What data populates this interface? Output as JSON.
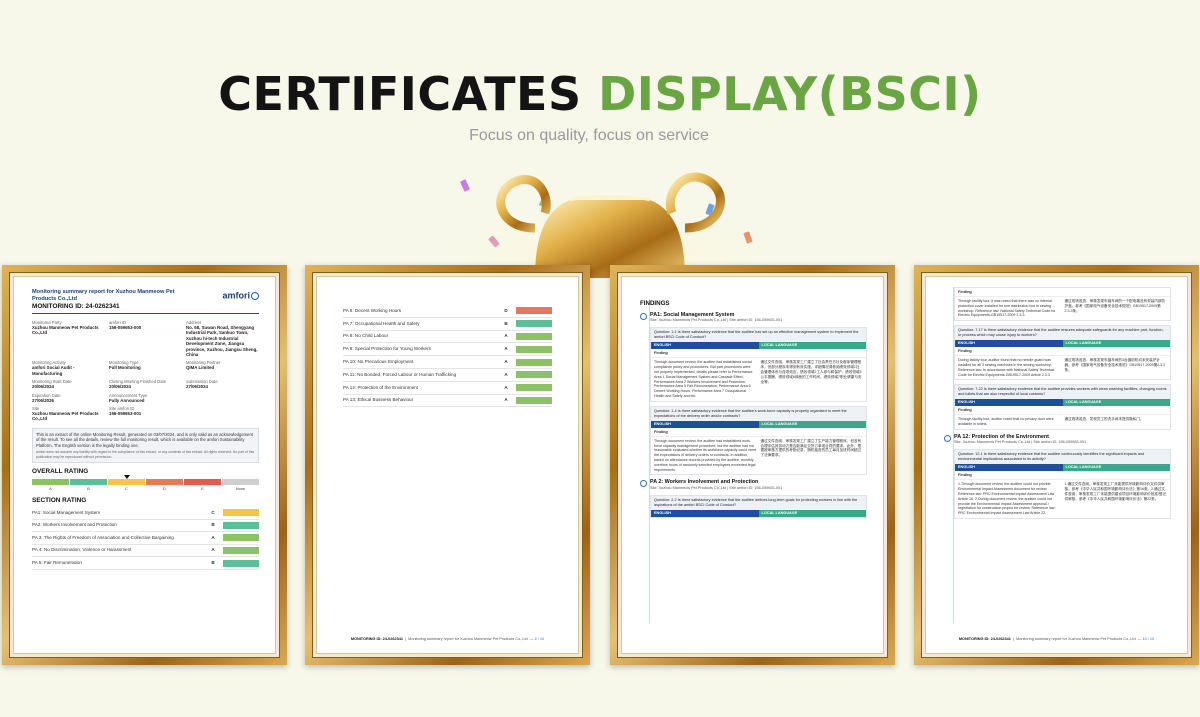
{
  "header": {
    "title_dark": "CERTIFICATES",
    "title_green": "DISPLAY(BSCI)",
    "subtitle": "Focus on quality, focus on service"
  },
  "colors": {
    "accent_green": "#6aa544",
    "grade_a": "#8cc265",
    "grade_b": "#5bbf9a",
    "grade_c": "#f4c54a",
    "grade_d": "#e8785c",
    "grade_e": "#e55a4a",
    "grade_none": "#cfcfcf"
  },
  "doc1": {
    "report_title": "Monitoring summary report for Xuzhou Manmeow Pet Products Co.,Ltd",
    "monitoring_id": "MONITORING ID: 24-0262341",
    "brand": "amfori",
    "fields": [
      {
        "label": "Monitored Party",
        "value": "Xuzhou Manmeow Pet Products Co.,Ltd"
      },
      {
        "label": "amfori ID",
        "value": "156-059653-000"
      },
      {
        "label": "Address",
        "value": "No. 68, Suwan Road, Shengyang Industrial Park, Sankuo Town, Xuzhou hi-tech Industrial Development Zone, Jiangsu province, Xuzhou, Jiangsu Sheng, China"
      },
      {
        "label": "Monitoring Activity",
        "value": "amfori Social Audit - Manufacturing"
      },
      {
        "label": "Monitoring Type",
        "value": "Full Monitoring"
      },
      {
        "label": "Monitoring Partner",
        "value": "QIMA Limited"
      },
      {
        "label": "Monitoring Start Date",
        "value": "20/06/2024"
      },
      {
        "label": "Closing Meeting Finished Date",
        "value": "20/06/2024"
      },
      {
        "label": "Submission Date",
        "value": "27/06/2024"
      },
      {
        "label": "Expiration Date",
        "value": "27/06/2026"
      },
      {
        "label": "Announcement Type",
        "value": "Fully Announced"
      },
      {
        "label": "",
        "value": ""
      },
      {
        "label": "Site",
        "value": "Xuzhou Manmeow Pet Products Co.,Ltd"
      },
      {
        "label": "Site amfori ID",
        "value": "156-059653-001"
      },
      {
        "label": "",
        "value": ""
      }
    ],
    "note_text": "This is an extract of the online Monitoring Result, generated on 03/07/2024, and is only valid as an acknowledgement of the result. To see all the details, review the full monitoring result, which is available on the amfori Sustainability Platform. The English version is the legally binding one.",
    "note_small": "amfori does not assume any liability with regard to the compliance of this extract, or any contents of this extract. All rights reserved. No part of this publication may be reproduced without permission.",
    "overall_rating_label": "OVERALL RATING",
    "grades": [
      "A",
      "B",
      "C",
      "D",
      "E",
      "None"
    ],
    "overall_grade": "C",
    "section_rating_label": "SECTION RATING",
    "sections": [
      {
        "name": "PA1: Social Management System",
        "grade": "C"
      },
      {
        "name": "PA2: Workers Involvement and Protection",
        "grade": "B"
      },
      {
        "name": "PA 3: The Rights of Freedom of Association and Collective Bargaining",
        "grade": "A"
      },
      {
        "name": "PA 4: No Discrimination, Violence or Harassment",
        "grade": "A"
      },
      {
        "name": "PA 5: Fair Remuneration",
        "grade": "B"
      }
    ]
  },
  "doc2": {
    "sections": [
      {
        "name": "PA 6: Decent Working Hours",
        "grade": "D"
      },
      {
        "name": "PA 7: Occupational Health and Safety",
        "grade": "B"
      },
      {
        "name": "PA 8: No Child Labour",
        "grade": "A"
      },
      {
        "name": "PA 9: Special Protection for Young Workers",
        "grade": "A"
      },
      {
        "name": "PA 10: No Precarious Employment",
        "grade": "A"
      },
      {
        "name": "PA 11: No Bonded, Forced Labour or Human Trafficking",
        "grade": "A"
      },
      {
        "name": "PA 12: Protection of the Environment",
        "grade": "A"
      },
      {
        "name": "PA 13: Ethical Business Behaviour",
        "grade": "A"
      }
    ],
    "footer_id": "MONITORING ID: 24-0262341",
    "footer_text": "Monitoring summary report for Xuzhou Manmeow Pet Products Co.,Ltd",
    "footer_page": "2 / 10"
  },
  "doc3": {
    "findings": "FINDINGS",
    "pa1_title": "PA1: Social Management System",
    "pa1_sub": "Site: Xuzhou Manmeow Pet Products Co.,Ltd | Site amfori ID: 156-059653-001",
    "q1": "Question: 1.1 Is there satisfactory evidence that the auditee has set up an effective management system to implement the amfori BSCI Code of Conduct?",
    "english": "ENGLISH",
    "local": "LOCAL LANGUAGE",
    "finding": "Finding",
    "f1_en": "Through document review, the auditee had established social compliance policy and procedures. But part procedures were not properly implemented, details please refer to Performance Area 1 Social Management System and Cascade Effect, Performance Area 2 Workers Involvement and Protection, Performance Area 5 Fair Remuneration, Performance Area 6 Decent Working Hours, Performance Area 7 Occupational Health and Safety and etc.",
    "f1_ll": "通过文件查阅，审核发现工厂建立了社会责任方针及程序管理程序，但部分程序未得到有效实施，详细情况请参阅绩效领域1社会管理体系与连带效应，绩效领域2工人参与和保护，绩效领域5公平报酬，绩效领域6体面的工作时间，绩效领域7职业健康与安全等。",
    "q2": "Question: 1.4 Is there satisfactory evidence that the auditee's work-force capacity is properly organised to meet the expectations of the delivery order and/or contracts?",
    "f2_en": "Through document review, the auditee had established work-force capacity management procedure, but the auditee had not reasonable evaluated whether its workforce capacity could meet the expectations of delivery orders or contracts. In addition, based on attendance records provided by the auditee, monthly overtime hours of randomly selected employees exceeded legal requirements.",
    "f2_ll": "通过文件查阅，审核发现工厂建立了生产能力管理程序，但没有合理评估其劳动力是否能满足交货订单或合同的要求。此外，根据被审核方提供的考勤记录，随机抽查的员工每月加班时间超过了法律要求。",
    "pa2_title": "PA 2: Workers Involvement and Protection",
    "pa2_sub": "Site: Xuzhou Manmeow Pet Products Co.,Ltd | Site amfori ID: 156-059653-001",
    "q3": "Question: 2.2 Is there satisfactory evidence that the auditee defines long-term goals for protecting workers in line with the aspirations of the amfori BSCI Code of Conduct?"
  },
  "doc4": {
    "f1_en": "Through facility tour, it was noted that there was no internal protection cover installed for one distribution box in sewing workshop. Reference law: National Safety Technical Code for Electric Equipments-GB19517-2009 2.3.3.",
    "f1_ll": "通过现场巡查，审核发现车缝车间的一个配电箱没有安装内部防护盖。参考《国家电气设备安全技术规范》GB19517-2009第2.3.3条。",
    "q2": "Question: 7.17 Is there satisfactory evidence that the auditee ensures adequate safeguards for any machine part, function, or process which may cause injury to workers?",
    "f2_en": "During facility tour, auditor found that no needle guard was installed for all 3 sewing machines in the sewing workshop. Reference law: In accordance with National Safety Technical Code for Electric Equipments-GB19517-2009 Article 2.3.3",
    "f2_ll": "通过现场巡查，审核发现车缝车间的3台缝纫机均未安装护针器。参考《国家电气设备安全技术规范》GB19517-2009第2.3.3条。",
    "q3": "Question: 7.22 Is there satisfactory evidence that the auditee provides workers with clean washing facilities, changing rooms and toilets that are also respectful of local customs?",
    "f3_en": "Through facility tour, auditor noted that no privacy door were available in toilets.",
    "f3_ll": "通过现场巡查，发现员工的洗手间未提供隐私门。",
    "pa12_title": "PA 12: Protection of the Environment",
    "pa12_sub": "Site: Xuzhou Manmeow Pet Products Co.,Ltd | Site amfori ID: 156-059653-001",
    "q4": "Question: 12.1 Is there satisfactory evidence that the auditee continuously identifies the significant impacts and environmental implications associated to its activity?",
    "f4_en": "1.Through document review, the auditee could not provide Environmental Impact Assessment document for review. Reference law: PRC Environmental Impact Assessment Law Article 16. 2.During document review, the auditee could not provide the Environmental Impact Assessment approval / registration for construction project for review. Reference law: PRC Environmental Impact Assessment Law Article 22.",
    "f4_ll": "1.通过文件查阅，审核发现工厂未能提供环境影响评价文件供审核。参考《中华人民共和国环境影响评价法》第16条。2.通过文件查阅，审核发现工厂未能提供建设项目环境影响评价批准/登记供审核。参考《中华人民共和国环境影响评价法》第22条。",
    "footer_page": "10 / 10"
  }
}
